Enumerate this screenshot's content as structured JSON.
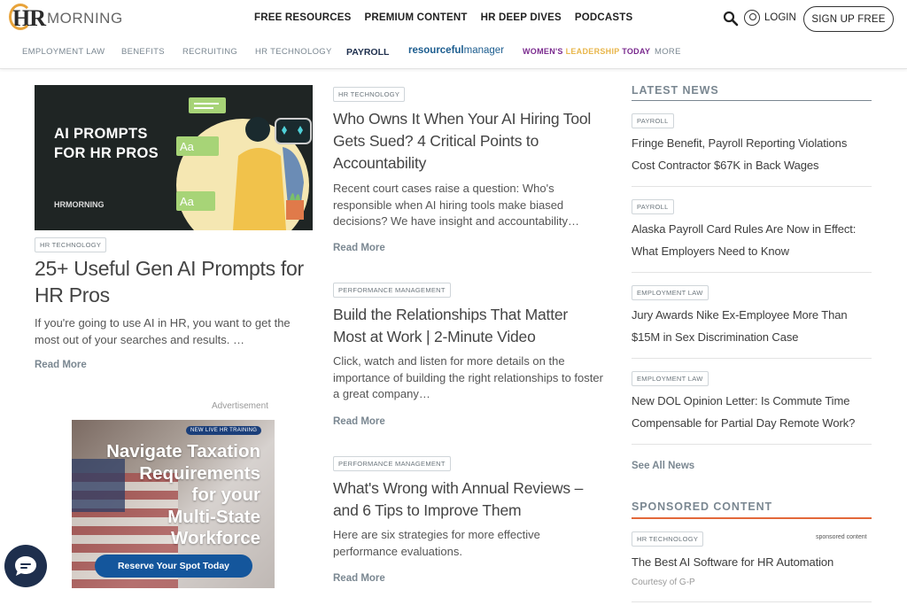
{
  "header": {
    "logo_hr": "HR",
    "logo_rest": "MORNING",
    "nav": [
      "FREE RESOURCES",
      "PREMIUM CONTENT",
      "HR DEEP DIVES",
      "PODCASTS"
    ],
    "login": "LOGIN",
    "signup": "SIGN UP FREE",
    "icons": {
      "search": "search-icon",
      "user": "user-icon"
    }
  },
  "subnav": {
    "employment_law": "EMPLOYMENT LAW",
    "benefits": "BENEFITS",
    "recruiting": "RECRUITING",
    "hr_technology": "HR TECHNOLOGY",
    "payroll": "PAYROLL",
    "resourceful_a": "resourceful",
    "resourceful_b": "manager",
    "women_a": "WOMEN'S",
    "women_b": "LEADERSHIP",
    "women_c": "TODAY",
    "more": "MORE"
  },
  "feature": {
    "image_title_line1": "AI PROMPTS",
    "image_title_line2": "FOR HR PROS",
    "image_logo": "HRMORNING",
    "tag": "HR TECHNOLOGY",
    "title": "25+ Useful Gen AI Prompts for HR Pros",
    "excerpt": "If you're going to use AI in HR, you want to get the most out of your searches and results. …",
    "read_more": "Read More"
  },
  "ad": {
    "label": "Advertisement",
    "badge": "NEW LIVE HR TRAINING",
    "line1": "Navigate Taxation",
    "line2": "Requirements",
    "line3": "for your",
    "line4": "Multi-State",
    "line5": "Workforce",
    "button": "Reserve Your Spot Today"
  },
  "articles": [
    {
      "tag": "HR TECHNOLOGY",
      "title": "Who Owns It When Your AI Hiring Tool Gets Sued? 4 Critical Points to Accountability",
      "excerpt": "Recent court cases raise a question: Who's responsible when AI hiring tools make biased decisions? We have insight and accountability…",
      "read_more": "Read More"
    },
    {
      "tag": "PERFORMANCE MANAGEMENT",
      "title": "Build the Relationships That Matter Most at Work | 2-Minute Video",
      "excerpt": "Click, watch and listen for more details on the importance of building the right relationships to foster a great company…",
      "read_more": "Read More"
    },
    {
      "tag": "PERFORMANCE MANAGEMENT",
      "title": "What's Wrong with Annual Reviews – and 6 Tips to Improve Them",
      "excerpt": "Here are six strategies for more effective performance evaluations.",
      "read_more": "Read More"
    }
  ],
  "latest_news": {
    "heading": "LATEST NEWS",
    "items": [
      {
        "tag": "PAYROLL",
        "title": "Fringe Benefit, Payroll Reporting Violations Cost Contractor $67K in Back Wages"
      },
      {
        "tag": "PAYROLL",
        "title": "Alaska Payroll Card Rules Are Now in Effect: What Employers Need to Know"
      },
      {
        "tag": "EMPLOYMENT LAW",
        "title": "Jury Awards Nike Ex-Employee More Than $15M in Sex Discrimination Case"
      },
      {
        "tag": "EMPLOYMENT LAW",
        "title": "New DOL Opinion Letter: Is Commute Time Compensable for Partial Day Remote Work?"
      }
    ],
    "see_all": "See All News"
  },
  "sponsored": {
    "heading": "SPONSORED CONTENT",
    "tag": "HR TECHNOLOGY",
    "label": "sponsored content",
    "title": "The Best AI Software for HR Automation",
    "courtesy": "Courtesy of G-P"
  },
  "colors": {
    "accent_orange": "#e3683a",
    "navy": "#1e2f4d",
    "muted": "#7a8791",
    "logo_ring": "#e8a33a"
  }
}
